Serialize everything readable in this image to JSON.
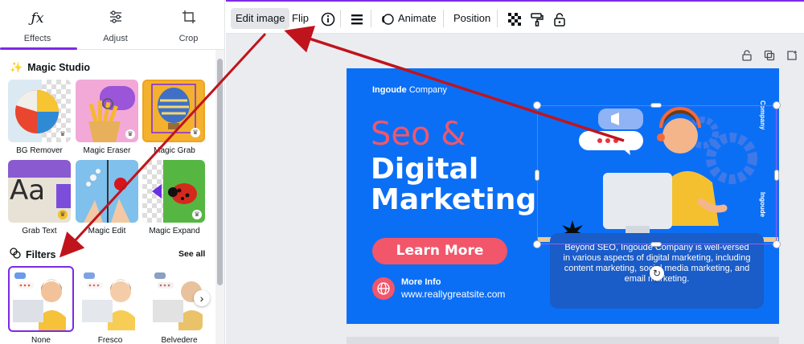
{
  "tabs": [
    {
      "label": "Effects",
      "icon": "fx-icon"
    },
    {
      "label": "Adjust",
      "icon": "sliders-icon"
    },
    {
      "label": "Crop",
      "icon": "crop-icon"
    }
  ],
  "magic_studio": {
    "title": "Magic Studio",
    "tools": [
      {
        "label": "BG Remover"
      },
      {
        "label": "Magic Eraser"
      },
      {
        "label": "Magic Grab"
      },
      {
        "label": "Grab Text"
      },
      {
        "label": "Magic Edit"
      },
      {
        "label": "Magic Expand"
      }
    ]
  },
  "filters": {
    "title": "Filters",
    "see_all": "See all",
    "items": [
      {
        "label": "None"
      },
      {
        "label": "Fresco"
      },
      {
        "label": "Belvedere"
      }
    ]
  },
  "toolbar": {
    "edit_image": "Edit image",
    "flip": "Flip",
    "animate": "Animate",
    "position": "Position"
  },
  "design": {
    "brand": "Ingoude",
    "brand_suffix": "Company",
    "headline_1": "Seo &",
    "headline_2": "Digital",
    "headline_3": "Marketing",
    "cta": "Learn More",
    "more_info": "More Info",
    "website": "www.reallygreatsite.com",
    "description": "Beyond SEO, Ingoude Company is well-versed in various aspects of digital marketing, including content marketing, social media marketing, and email marketing.",
    "side_label": "Company",
    "side_label_2": "Ingoude"
  },
  "colors": {
    "accent": "#7d2ae8",
    "design_bg": "#0b6ff5",
    "headline_red": "#f2566a",
    "arrow_red": "#c0141c"
  }
}
